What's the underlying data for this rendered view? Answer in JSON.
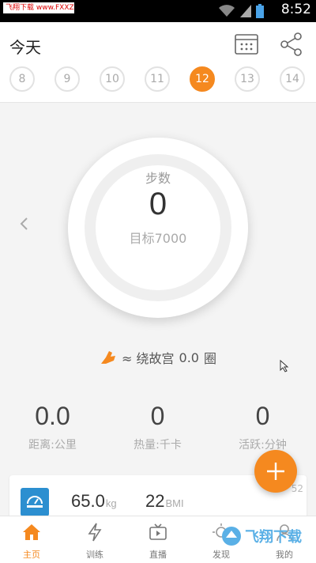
{
  "status_bar": {
    "time": "8:52",
    "site_logo": "飞翔下载 www.FXXZ.com"
  },
  "header": {
    "title": "今天",
    "dates": [
      {
        "label": "8",
        "active": false
      },
      {
        "label": "9",
        "active": false
      },
      {
        "label": "10",
        "active": false
      },
      {
        "label": "11",
        "active": false
      },
      {
        "label": "12",
        "active": true
      },
      {
        "label": "13",
        "active": false
      },
      {
        "label": "14",
        "active": false
      }
    ]
  },
  "steps": {
    "title": "步数",
    "value": "0",
    "goal": "目标7000"
  },
  "compare": {
    "prefix": "≈ 绕故宫",
    "value": "0.0",
    "unit": "圈"
  },
  "stats": [
    {
      "value": "0.0",
      "label": "距离:公里"
    },
    {
      "value": "0",
      "label": "热量:千卡"
    },
    {
      "value": "0",
      "label": "活跃:分钟"
    }
  ],
  "body_card": {
    "weight": "65.0",
    "weight_unit": "kg",
    "bmi": "22",
    "bmi_unit": "BMI",
    "side_text": "52"
  },
  "bottom_nav": [
    {
      "label": "主页",
      "icon": "home-icon",
      "active": true
    },
    {
      "label": "训练",
      "icon": "lightning-icon",
      "active": false
    },
    {
      "label": "直播",
      "icon": "tv-icon",
      "active": false
    },
    {
      "label": "发现",
      "icon": "discover-icon",
      "active": false
    },
    {
      "label": "我的",
      "icon": "person-icon",
      "active": false
    }
  ],
  "watermark": "飞翔下载",
  "colors": {
    "accent": "#f5891f",
    "scale_blue": "#2c8fd0"
  }
}
